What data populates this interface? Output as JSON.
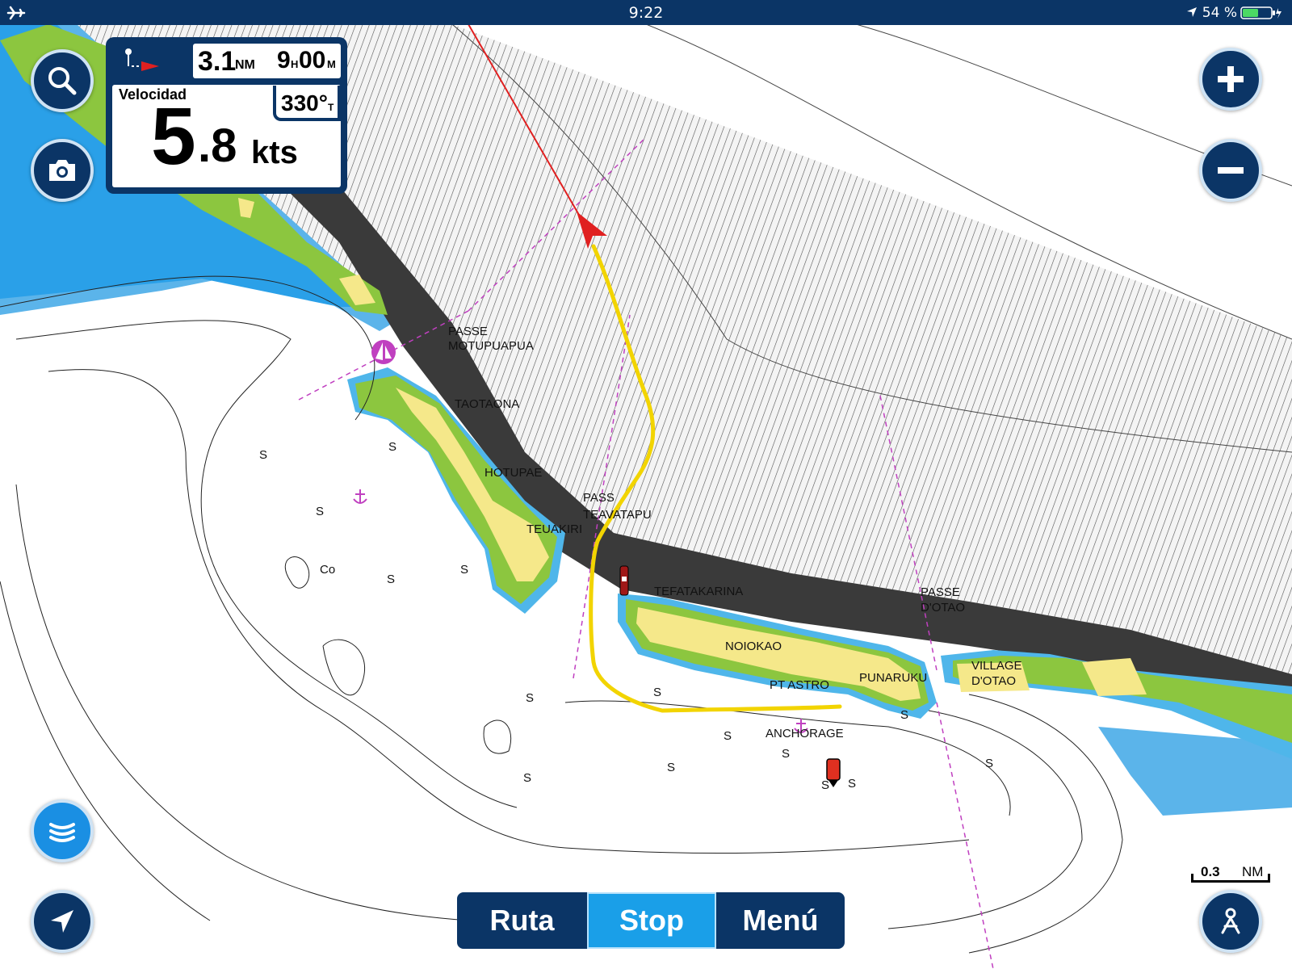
{
  "status_bar": {
    "time": "9:22",
    "battery": "54 %"
  },
  "nav_panel": {
    "distance_value": "3.1",
    "distance_unit": "NM",
    "eta_hours": "9",
    "eta_h": "H",
    "eta_minutes": "00",
    "eta_m": "M",
    "speed_label": "Velocidad",
    "speed_int": "5",
    "speed_dec": ".8",
    "speed_unit": "kts",
    "heading": "330°",
    "heading_ref": "T"
  },
  "toolbar": {
    "route": "Ruta",
    "stop": "Stop",
    "menu": "Menú"
  },
  "scale": {
    "value": "0.3",
    "unit": "NM"
  },
  "map_labels": {
    "passe_motu_1": "PASSE",
    "passe_motu_2": "MOTUPUAPUA",
    "taotaona": "TAOTAONA",
    "hotupae": "HOTUPAE",
    "pass_tea_1": "PASS",
    "pass_tea_2": "TEAVATAPU",
    "teuakiri": "TEUAKIRI",
    "tefatakarina": "TEFATAKARINA",
    "passe_otao_1": "PASSE",
    "passe_otao_2": "D'OTAO",
    "noiokao": "NOIOKAO",
    "pt_astro": "PT ASTRO",
    "punaruku": "PUNARUKU",
    "village_1": "VILLAGE",
    "village_2": "D'OTAO",
    "anchorage": "ANCHORAGE",
    "coral": "Co",
    "sand_1": "S",
    "sand_2": "S",
    "sand_3": "S",
    "sand_4": "S",
    "sand_5": "S",
    "sand_6": "S",
    "sand_7": "S",
    "sand_8": "S",
    "sand_9": "S",
    "sand_10": "S",
    "sand_11": "S",
    "sand_12": "S",
    "sand_13": "S",
    "sand_14": "S",
    "sand_15": "S"
  },
  "icons": {
    "search": "search-icon",
    "camera": "camera-icon",
    "zoom_in": "plus-icon",
    "zoom_out": "minus-icon",
    "sonar": "sonar-icon",
    "locate": "navigation-arrow-icon",
    "profile": "person-icon",
    "airplane": "airplane-icon"
  },
  "colors": {
    "panel": "#0b3566",
    "active": "#1a9fe8",
    "track": "#f2d400",
    "heading_line": "#e02020",
    "land": "#f5e88a",
    "reef": "#8cc63f",
    "deep": "#3a3a3a"
  }
}
